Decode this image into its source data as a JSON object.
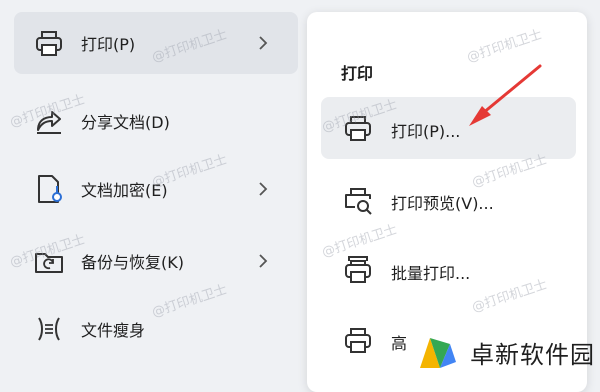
{
  "left_menu": {
    "items": [
      {
        "label": "打印(P)",
        "icon": "printer-icon",
        "has_submenu": true,
        "active": true
      },
      {
        "label": "分享文档(D)",
        "icon": "share-icon",
        "has_submenu": false
      },
      {
        "label": "文档加密(E)",
        "icon": "encrypt-icon",
        "has_submenu": true
      },
      {
        "label": "备份与恢复(K)",
        "icon": "backup-icon",
        "has_submenu": true
      },
      {
        "label": "文件瘦身",
        "icon": "slim-icon",
        "has_submenu": false
      }
    ]
  },
  "submenu": {
    "title": "打印",
    "items": [
      {
        "label": "打印(P)...",
        "icon": "printer-icon",
        "active": true
      },
      {
        "label": "打印预览(V)...",
        "icon": "print-preview-icon"
      },
      {
        "label": "批量打印...",
        "icon": "batch-print-icon"
      },
      {
        "label": "高",
        "icon": "printer-icon"
      }
    ]
  },
  "watermark": "@打印机卫士",
  "logo": {
    "text": "卓新软件园"
  },
  "colors": {
    "active_bg": "#e1e4e9",
    "submenu_bg": "#ffffff",
    "arrow": "#e53935"
  }
}
